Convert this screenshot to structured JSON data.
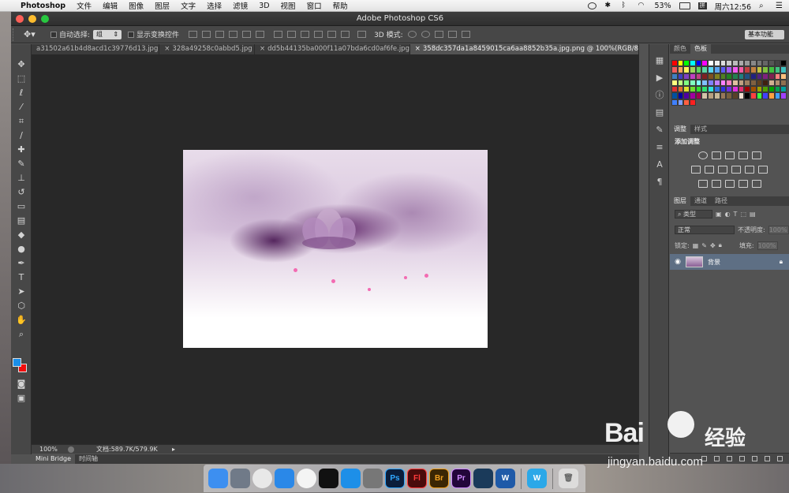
{
  "menubar": {
    "app_name": "Photoshop",
    "items": [
      "文件",
      "编辑",
      "图像",
      "图层",
      "文字",
      "选择",
      "滤镜",
      "3D",
      "视图",
      "窗口",
      "帮助"
    ],
    "battery": "53%",
    "clock": "周六12:56"
  },
  "window": {
    "title": "Adobe Photoshop CS6"
  },
  "options_bar": {
    "auto_select_label": "自动选择:",
    "auto_select_value": "组",
    "show_transform_label": "显示变换控件",
    "mode_3d_label": "3D 模式:",
    "workspace": "基本功能"
  },
  "tabs": [
    {
      "label": "a31502a61b4d8acd1c39776d13.jpg",
      "active": false
    },
    {
      "label": "328a49258c0abbd5.jpg",
      "active": false
    },
    {
      "label": "dd5b44135ba000f11a07bda6cd0af6fe.jpg",
      "active": false
    },
    {
      "label": "358dc357da1a8459015ca6aa8852b35a.jpg.png @ 100%(RGB/8)",
      "active": true
    }
  ],
  "status": {
    "zoom": "100%",
    "doc": "文档:589.7K/579.9K"
  },
  "bottom_tabs": [
    "Mini Bridge",
    "时间轴"
  ],
  "swatches": {
    "tabs": [
      "颜色",
      "色板"
    ],
    "colors": [
      "#ff0000",
      "#ffff00",
      "#00ff00",
      "#00ffff",
      "#0000ff",
      "#ff00ff",
      "#ffffff",
      "#eeeeee",
      "#dddddd",
      "#cccccc",
      "#bbbbbb",
      "#aaaaaa",
      "#999999",
      "#888888",
      "#777777",
      "#666666",
      "#555555",
      "#444444",
      "#000000",
      "#f25c5c",
      "#f5a35c",
      "#fff25c",
      "#9ed65c",
      "#5cd65c",
      "#5cd6a3",
      "#5cd6f2",
      "#5ca3f2",
      "#5c5cf2",
      "#a35cf2",
      "#f25cf2",
      "#f25ca3",
      "#c04040",
      "#c08040",
      "#c0c040",
      "#80c040",
      "#40c040",
      "#40c080",
      "#40c0c0",
      "#4080c0",
      "#4040c0",
      "#8040c0",
      "#c040c0",
      "#c04080",
      "#802020",
      "#805020",
      "#808020",
      "#508020",
      "#208020",
      "#208050",
      "#208080",
      "#205080",
      "#202080",
      "#502080",
      "#802080",
      "#802050",
      "#ff8080",
      "#ffc080",
      "#ffff80",
      "#c0ff80",
      "#80ff80",
      "#80ffc0",
      "#80ffff",
      "#80c0ff",
      "#8080ff",
      "#c080ff",
      "#ff80ff",
      "#ff80c0",
      "#e0c0a0",
      "#c0a080",
      "#a08060",
      "#806040",
      "#604020",
      "#402010",
      "#d0b090",
      "#b09070",
      "#907050",
      "#e03030",
      "#e07030",
      "#e0e030",
      "#70e030",
      "#30e030",
      "#30e070",
      "#30e0e0",
      "#3070e0",
      "#3030e0",
      "#7030e0",
      "#e030e0",
      "#e03070",
      "#a00000",
      "#a05000",
      "#a0a000",
      "#50a000",
      "#00a000",
      "#00a050",
      "#00a0a0",
      "#0050a0",
      "#0000a0",
      "#5000a0",
      "#a000a0",
      "#a00050",
      "#d4c4a8",
      "#b8a080",
      "#c8b898",
      "#987858",
      "#786040",
      "#584028",
      "#f0e0d0",
      "#000000",
      "#ff4040",
      "#40ff40",
      "#4040ff",
      "#ffa040",
      "#40a0ff",
      "#a040ff",
      "#4080ff",
      "#80a0ff",
      "#ff6040",
      "#ff2020"
    ]
  },
  "adjustments": {
    "tabs": [
      "调整",
      "样式"
    ],
    "title": "添加调整"
  },
  "layers": {
    "tabs": [
      "图层",
      "通道",
      "路径"
    ],
    "filter_label": "类型",
    "blend_mode": "正常",
    "opacity_label": "不透明度:",
    "opacity_value": "100%",
    "lock_label": "锁定:",
    "fill_label": "填充:",
    "fill_value": "100%",
    "layer_name": "背景"
  },
  "dock_apps": [
    {
      "name": "finder",
      "label": "",
      "color": "#3d8ff0"
    },
    {
      "name": "launchpad",
      "label": "",
      "color": "#707a88"
    },
    {
      "name": "chrome",
      "label": "",
      "color": "#e8e8e8"
    },
    {
      "name": "safari",
      "label": "",
      "color": "#2a88e8"
    },
    {
      "name": "photos",
      "label": "",
      "color": "#f4f4f4"
    },
    {
      "name": "qq",
      "label": "",
      "color": "#111111"
    },
    {
      "name": "app-store",
      "label": "",
      "color": "#1d8fe8"
    },
    {
      "name": "system-preferences",
      "label": "",
      "color": "#777777"
    },
    {
      "name": "photoshop",
      "label": "Ps",
      "color": "#0a1d3a"
    },
    {
      "name": "flash",
      "label": "Fl",
      "color": "#4a0b0b"
    },
    {
      "name": "bridge",
      "label": "Br",
      "color": "#3a2604"
    },
    {
      "name": "premiere",
      "label": "Pr",
      "color": "#23063a"
    },
    {
      "name": "quicktime",
      "label": "",
      "color": "#1a3a5a"
    },
    {
      "name": "word",
      "label": "W",
      "color": "#1f5aa8"
    },
    {
      "name": "wunderlist",
      "label": "W",
      "color": "#2ba8e8"
    }
  ],
  "watermark": {
    "brand": "Bai",
    "brand2": "经验",
    "url": "jingyan.baidu.com"
  }
}
